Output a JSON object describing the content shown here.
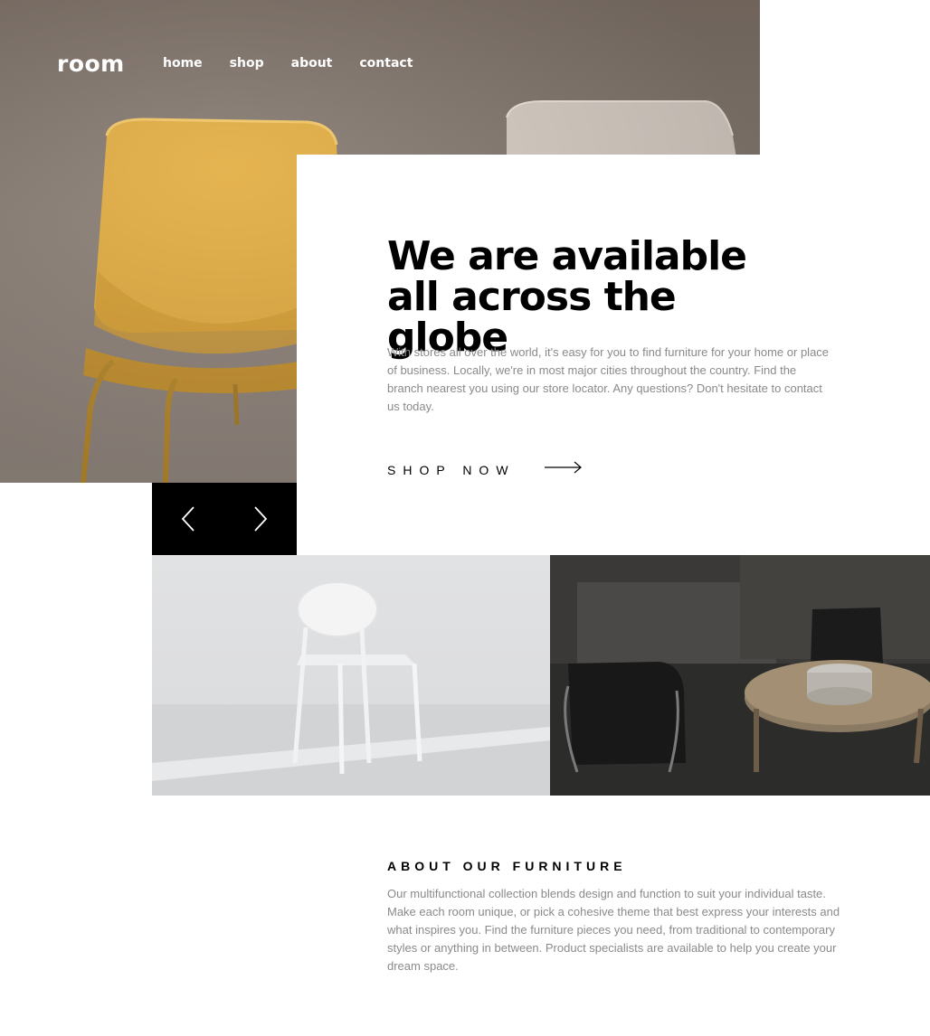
{
  "brand": {
    "logo": "room"
  },
  "nav": {
    "items": [
      "home",
      "shop",
      "about",
      "contact"
    ]
  },
  "hero": {
    "image": "yellow-and-white-chairs-photo",
    "headline": "We are available all across the globe",
    "body": "With stores all over the world, it's easy for you to find furniture for your home or place of business. Locally, we're in most major cities throughout the country. Find the branch nearest you using our store locator. Any questions? Don't hesitate to contact us today.",
    "cta": "SHOP NOW",
    "cta_icon": "arrow-right-icon"
  },
  "slider": {
    "prev_icon": "chevron-left-icon",
    "next_icon": "chevron-right-icon"
  },
  "gallery": {
    "left_image": "white-chair-photo",
    "right_image": "dark-living-room-photo"
  },
  "about": {
    "heading": "ABOUT OUR FURNITURE",
    "body": "Our multifunctional collection blends design and function to suit your individual taste. Make each room unique, or pick a cohesive theme that best express your interests and what inspires you. Find the furniture pieces you need, from traditional to contemporary styles or anything in between. Product specialists are available to help you create your dream space."
  },
  "colors": {
    "accent_black": "#000000",
    "text_gray": "#8a8a8a",
    "chair_yellow": "#e0a83a",
    "background": "#ffffff"
  }
}
